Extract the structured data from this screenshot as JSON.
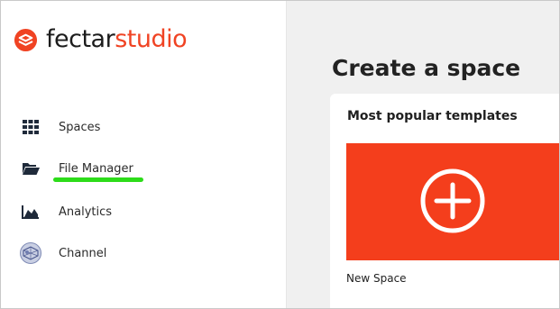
{
  "brand": {
    "name_part1": "fectar",
    "name_part2": "studio",
    "accent_color": "#f04323",
    "icon": "fectar-logo-icon"
  },
  "sidebar": {
    "items": [
      {
        "label": "Spaces",
        "icon": "grid-icon"
      },
      {
        "label": "File Manager",
        "icon": "folder-open-icon"
      },
      {
        "label": "Analytics",
        "icon": "area-chart-icon"
      },
      {
        "label": "Channel",
        "icon": "channel-avatar-icon"
      }
    ],
    "highlight_color": "#2ddc1a"
  },
  "main": {
    "title": "Create a space",
    "section_title": "Most popular templates",
    "templates": [
      {
        "label": "New Space",
        "icon": "plus-circle-icon",
        "color": "#f43e1c"
      }
    ]
  }
}
